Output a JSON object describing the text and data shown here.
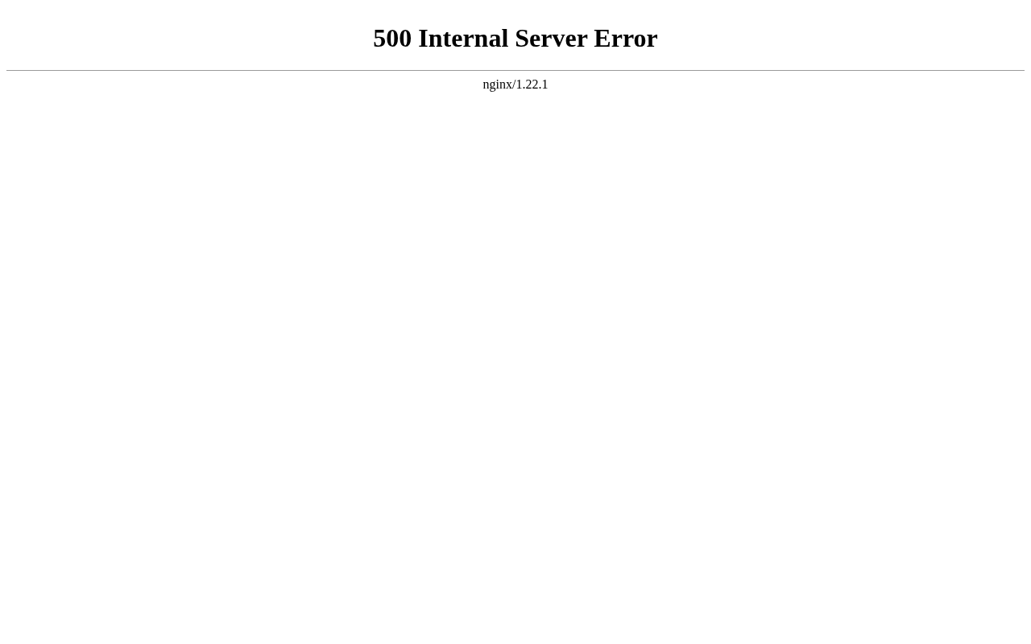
{
  "heading": "500 Internal Server Error",
  "server": "nginx/1.22.1"
}
